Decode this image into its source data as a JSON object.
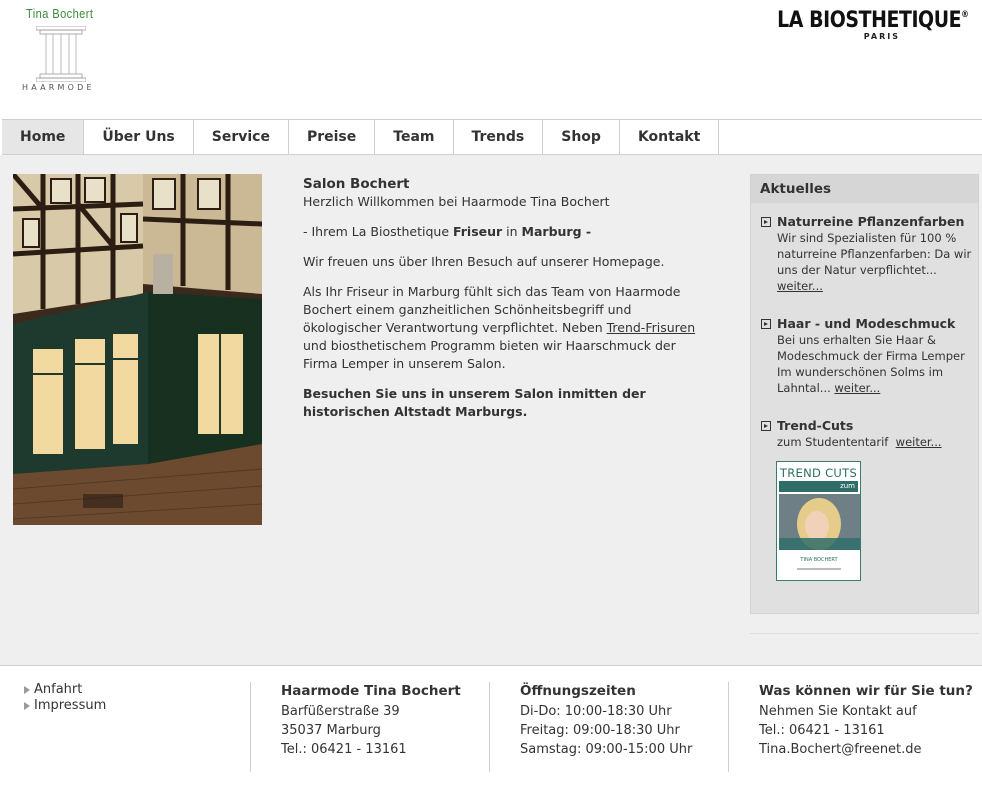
{
  "header": {
    "logo_brand": "Tina Bochert",
    "logo_sub": "HAARMODE",
    "partner_logo": "LA BIOSTHETIQUE",
    "partner_mark": "®",
    "partner_city": "PARIS"
  },
  "nav": [
    {
      "label": "Home",
      "active": true
    },
    {
      "label": "Über Uns"
    },
    {
      "label": "Service"
    },
    {
      "label": "Preise"
    },
    {
      "label": "Team"
    },
    {
      "label": "Trends"
    },
    {
      "label": "Shop"
    },
    {
      "label": "Kontakt"
    }
  ],
  "content": {
    "title": "Salon Bochert",
    "welcome": "Herzlich Willkommen bei Haarmode Tina Bochert",
    "line2_a": "- Ihrem La Biosthetique ",
    "line2_b": "Friseur",
    "line2_c": " in ",
    "line2_d": "Marburg -",
    "para1": "Wir freuen uns über Ihren Besuch auf unserer Homepage.",
    "para2_a": "Als Ihr Friseur in Marburg fühlt sich das Team von Haarmode Bochert einem ganzheitlichen Schönheitsbegriff und ökologischer Verantwortung verpflichtet. Neben ",
    "para2_link": "Trend-Frisuren",
    "para2_b": " und biosthetischem Programm bieten wir Haarschmuck der Firma Lemper in unserem Salon.",
    "para3": "Besuchen Sie uns in unserem Salon inmitten der historischen Altstadt Marburgs."
  },
  "aktuelles": {
    "heading": "Aktuelles",
    "items": [
      {
        "title": "Naturreine Pflanzenfarben",
        "body": "Wir sind Spezialisten für 100 % naturreine Pflanzenfarben: Da wir uns der Natur verpflichtet...",
        "more": "weiter..."
      },
      {
        "title": "Haar - und Modeschmuck",
        "body": "Bei uns erhalten Sie Haar & Modeschmuck der Firma Lemper Im wunderschönen Solms im Lahntal...",
        "more": "weiter..."
      },
      {
        "title": "Trend-Cuts",
        "body": "zum Studententarif",
        "more": "weiter..."
      }
    ],
    "ad_title": "TREND CUTS",
    "ad_sub": "zum STUDENTENTARIF"
  },
  "footer": {
    "links": [
      "Anfahrt",
      "Impressum"
    ],
    "address": {
      "heading": "Haarmode Tina Bochert",
      "lines": [
        "Barfüßerstraße 39",
        "35037 Marburg",
        "Tel.: 06421 - 13161"
      ]
    },
    "hours": {
      "heading": "Öffnungszeiten",
      "lines": [
        "Di-Do: 10:00-18:30 Uhr",
        "Freitag: 09:00-18:30 Uhr",
        "Samstag: 09:00-15:00 Uhr"
      ]
    },
    "contact": {
      "heading": "Was können wir für Sie tun?",
      "lines": [
        "Nehmen Sie Kontakt auf",
        "Tel.: 06421 - 13161",
        "Tina.Bochert@freenet.de"
      ]
    }
  },
  "colors": {
    "brand_green": "#3a8a3a",
    "band_grey": "#efefef",
    "sidebar_grey": "#e0e0e0",
    "ad_teal": "#2f6e68"
  }
}
